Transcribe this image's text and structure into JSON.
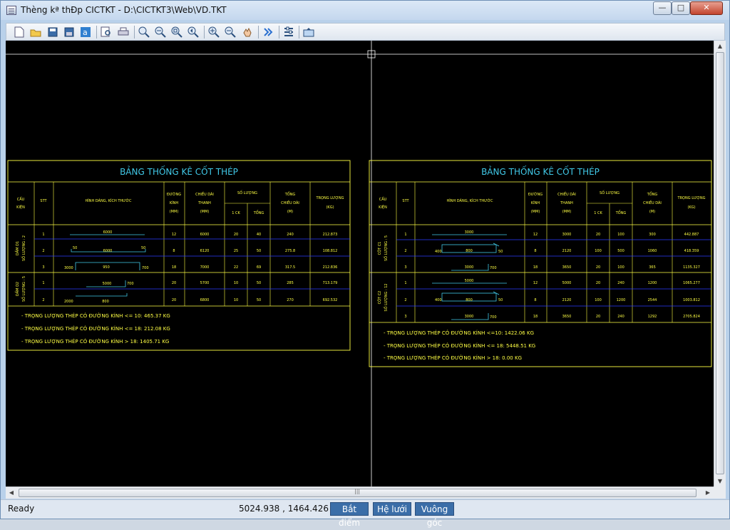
{
  "window": {
    "title": "Thèng kª thÐp CICTKT - D:\\CICTKT3\\Web\\VD.TKT",
    "min_glyph": "—",
    "max_glyph": "□",
    "close_glyph": "✕"
  },
  "toolbar": {
    "icons": [
      "new-file-icon",
      "open-file-icon",
      "save-icon",
      "save-as-icon",
      "font-icon",
      "print-preview-icon",
      "print-icon",
      "zoom-window-icon",
      "zoom-all-icon",
      "zoom-extents-icon",
      "zoom-previous-icon",
      "zoom-in-icon",
      "zoom-out-icon",
      "pan-icon",
      "next-icon",
      "settings-icon",
      "export-icon"
    ]
  },
  "tables": [
    {
      "title": "BẢNG THỐNG KÊ CỐT THÉP",
      "headers": {
        "ck": [
          "CẤU",
          "KIỆN"
        ],
        "stt": "STT",
        "shape": "HÌNH DÁNG, KÍCH THƯỚC",
        "dk": [
          "ĐƯỜNG",
          "KÍNH",
          "(MM)"
        ],
        "cd": [
          "CHIỀU DÀI",
          "THANH",
          "(MM)"
        ],
        "sl": "SỐ LƯỢNG",
        "sl1": "1 CK",
        "sl2": "TỔNG",
        "tcd": [
          "TỔNG",
          "CHIỀU DÀI",
          "(M)"
        ],
        "tl": [
          "TRỌNG LƯỢNG",
          "(KG)"
        ]
      },
      "groups": [
        {
          "name1": "DẦM D1",
          "name2": "SỐ LƯỢNG : 2"
        },
        {
          "name1": "DẦM D2",
          "name2": "SỐ LƯỢNG : 5"
        }
      ],
      "rows": [
        {
          "stt": "1",
          "dims": [
            "6000"
          ],
          "dk": "12",
          "cd": "6000",
          "sl1": "20",
          "sl2": "40",
          "tcd": "240",
          "tl": "212.873"
        },
        {
          "stt": "2",
          "dims": [
            "50",
            "6000",
            "50"
          ],
          "dk": "8",
          "cd": "6120",
          "sl1": "25",
          "sl2": "50",
          "tcd": "275.8",
          "tl": "108.812"
        },
        {
          "stt": "3",
          "dims": [
            "3000",
            "950",
            "700"
          ],
          "dk": "18",
          "cd": "7000",
          "sl1": "22",
          "sl2": "69",
          "tcd": "317.5",
          "tl": "212.836"
        },
        {
          "stt": "1",
          "dims": [
            "5000",
            "700"
          ],
          "dk": "20",
          "cd": "5700",
          "sl1": "10",
          "sl2": "50",
          "tcd": "285",
          "tl": "713.179"
        },
        {
          "stt": "2",
          "dims": [
            "2000",
            "800"
          ],
          "dk": "20",
          "cd": "6800",
          "sl1": "10",
          "sl2": "50",
          "tcd": "270",
          "tl": "692.532"
        }
      ],
      "summary": [
        "- TRỌNG LƯỢNG THÉP CÓ ĐƯỜNG KÍNH <= 10:    465.37  KG",
        "- TRỌNG LƯỢNG THÉP CÓ ĐƯỜNG KÍNH <= 18:    212.08  KG",
        "- TRỌNG LƯỢNG THÉP CÓ ĐƯỜNG KÍNH > 18:    1405.71  KG"
      ]
    },
    {
      "title": "BẢNG THỐNG KÊ CỐT THÉP",
      "groups": [
        {
          "name1": "CỘT C1",
          "name2": "SỐ LƯỢNG : 5"
        },
        {
          "name1": "CỘT C2",
          "name2": "SỐ LƯỢNG : 12"
        }
      ],
      "rows": [
        {
          "stt": "1",
          "dims": [
            "3000"
          ],
          "dk": "12",
          "cd": "3000",
          "sl1": "20",
          "sl2": "100",
          "tcd": "300",
          "tl": "442.887"
        },
        {
          "stt": "2",
          "dims": [
            "400",
            "800",
            "50"
          ],
          "dk": "8",
          "cd": "2120",
          "sl1": "100",
          "sl2": "500",
          "tcd": "1060",
          "tl": "418.359"
        },
        {
          "stt": "3",
          "dims": [
            "3000",
            "700"
          ],
          "dk": "18",
          "cd": "3650",
          "sl1": "20",
          "sl2": "100",
          "tcd": "365",
          "tl": "1135.327"
        },
        {
          "stt": "1",
          "dims": [
            "5000",
            "700"
          ],
          "dk": "12",
          "cd": "5000",
          "sl1": "20",
          "sl2": "240",
          "tcd": "1200",
          "tl": "1065.277"
        },
        {
          "stt": "2",
          "dims": [
            "400",
            "800",
            "50"
          ],
          "dk": "8",
          "cd": "2120",
          "sl1": "100",
          "sl2": "1200",
          "tcd": "2544",
          "tl": "1003.812"
        },
        {
          "stt": "3",
          "dims": [
            "3000",
            "700"
          ],
          "dk": "18",
          "cd": "3650",
          "sl1": "20",
          "sl2": "240",
          "tcd": "1292",
          "tl": "2705.824"
        }
      ],
      "summary": [
        "- TRỌNG LƯỢNG THÉP CÓ ĐƯỜNG KÍNH <=10:    1422.06  KG",
        "- TRỌNG LƯỢNG THÉP CÓ ĐƯỜNG KÍNH <= 18:    5448.51  KG",
        "- TRỌNG LƯỢNG THÉP CÓ ĐƯỜNG KÍNH > 18:      0.00  KG"
      ]
    }
  ],
  "status": {
    "ready": "Ready",
    "coords": "5024.938 , 1464.426",
    "snap": "Bắt điểm",
    "grid": "Hệ lưới",
    "ortho": "Vuông góc"
  }
}
